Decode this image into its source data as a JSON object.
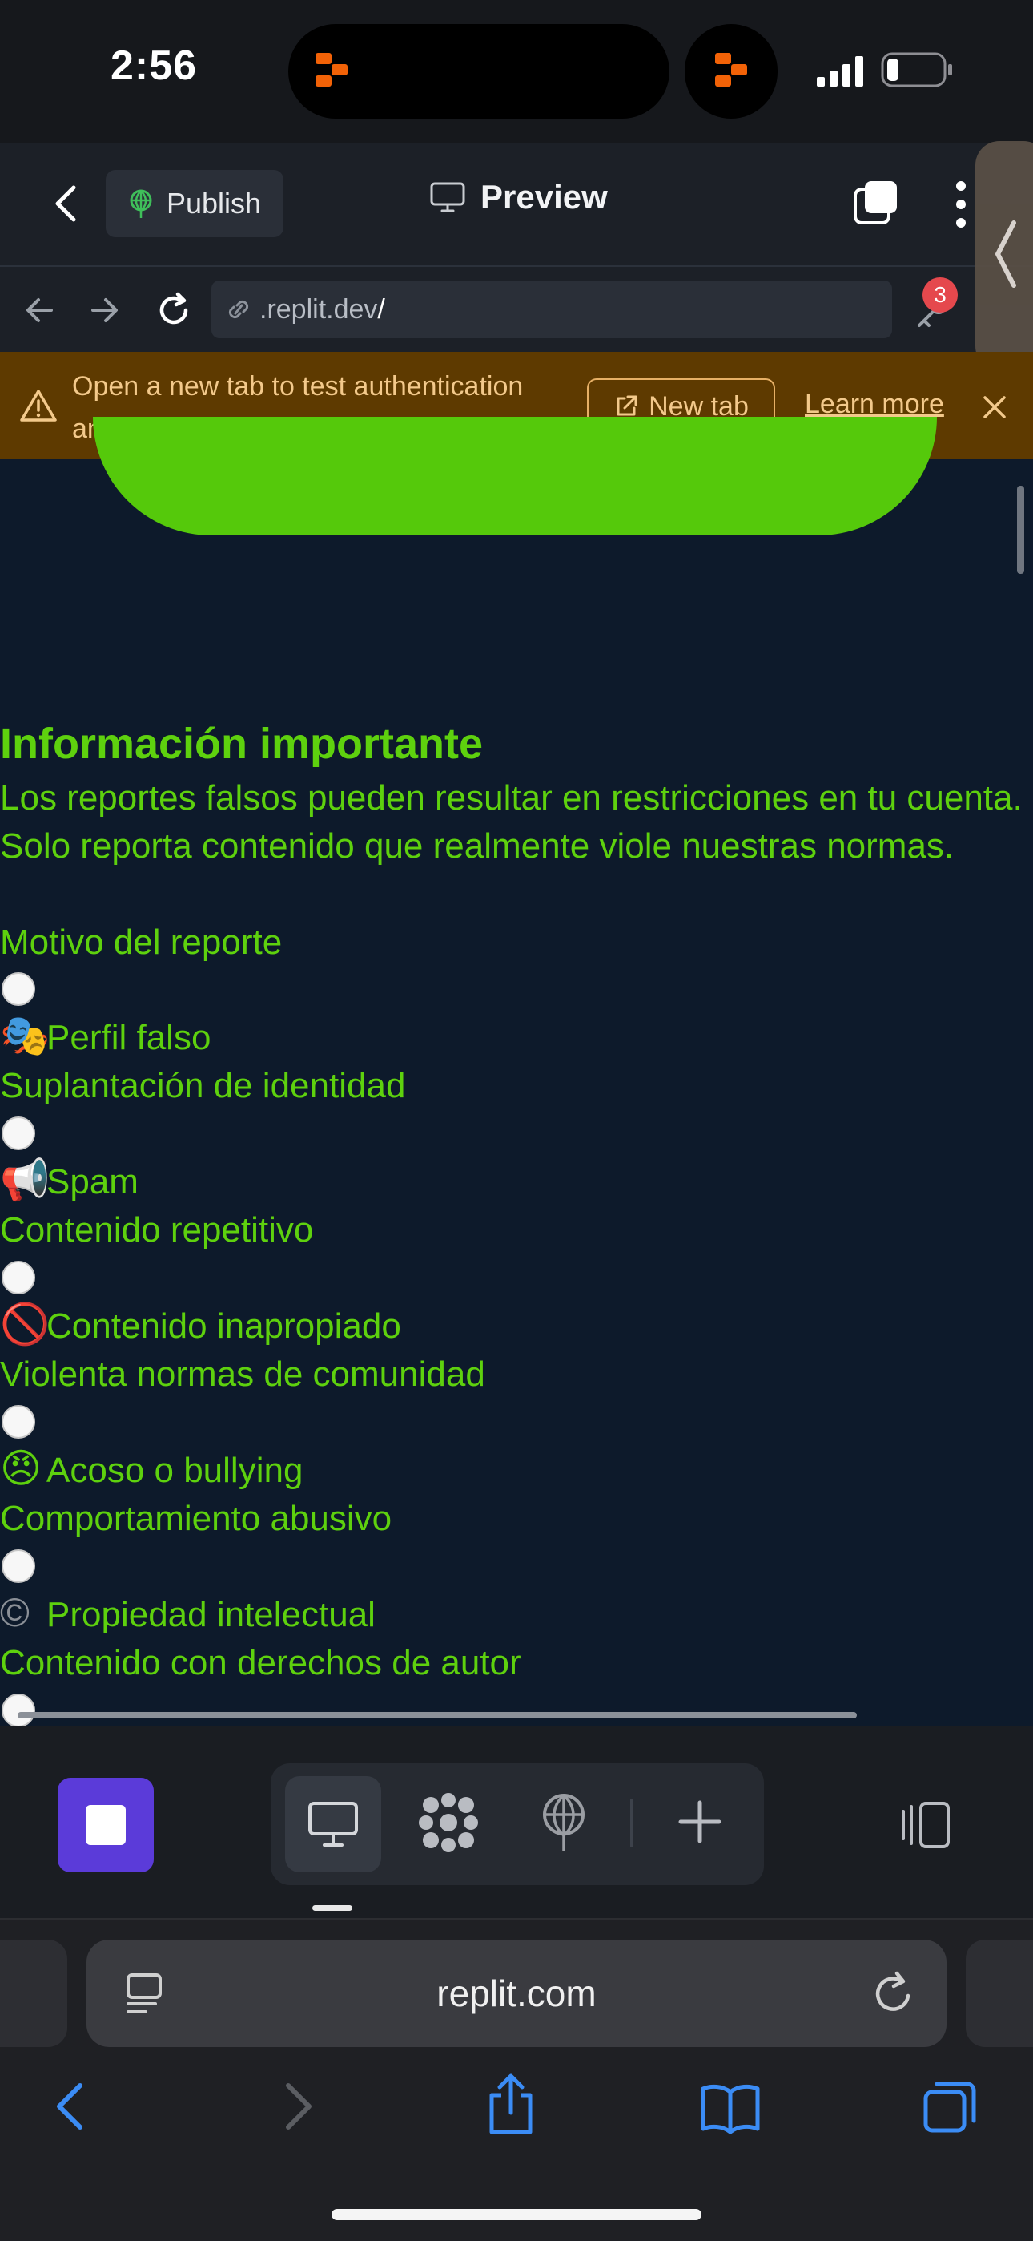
{
  "status_bar": {
    "time": "2:56"
  },
  "topbar": {
    "publish_label": "Publish",
    "preview_label": "Preview"
  },
  "urlbar": {
    "url_text": ".replit.dev",
    "url_slash": "/",
    "badge_count": "3"
  },
  "banner": {
    "message": "Open a new tab to test authentication and file uploads.",
    "new_tab_label": "New tab",
    "learn_more_label": "Learn more"
  },
  "content": {
    "info_heading": "Información importante",
    "info_body": "Los reportes falsos pueden resultar en restricciones en tu cuenta. Solo reporta contenido que realmente viole nuestras normas.",
    "reason_label": "Motivo del reporte",
    "options": [
      {
        "emoji": "🎭",
        "title": "Perfil falso",
        "desc": "Suplantación de identidad"
      },
      {
        "emoji": "📢",
        "title": "Spam",
        "desc": "Contenido repetitivo"
      },
      {
        "emoji": "🚫",
        "title": "Contenido inapropiado",
        "desc": "Violenta normas de comunidad"
      },
      {
        "emoji": "😠",
        "title": "Acoso o bullying",
        "desc": "Comportamiento abusivo"
      },
      {
        "emoji": "©",
        "title": "Propiedad intelectual",
        "desc": "Contenido con derechos de autor"
      }
    ]
  },
  "safari": {
    "address": "replit.com"
  },
  "colors": {
    "accent_green": "#5ed10e",
    "banner_bg": "#5e3a00",
    "stop_button": "#5b3bd9",
    "safari_blue": "#3b8cf5"
  },
  "icons": [
    "back-chevron-icon",
    "publish-globe-icon",
    "preview-monitor-icon",
    "devtools-icon",
    "more-icon",
    "nav-back-icon",
    "nav-forward-icon",
    "reload-icon",
    "link-icon",
    "key-icon",
    "warning-icon",
    "external-link-icon",
    "close-icon",
    "stop-icon",
    "monitor-icon",
    "apps-icon",
    "deploy-icon",
    "plus-icon",
    "layout-icon",
    "tabs-list-icon",
    "safari-reload-icon",
    "safari-back-icon",
    "safari-forward-icon",
    "share-icon",
    "bookmarks-icon",
    "tabs-icon"
  ]
}
